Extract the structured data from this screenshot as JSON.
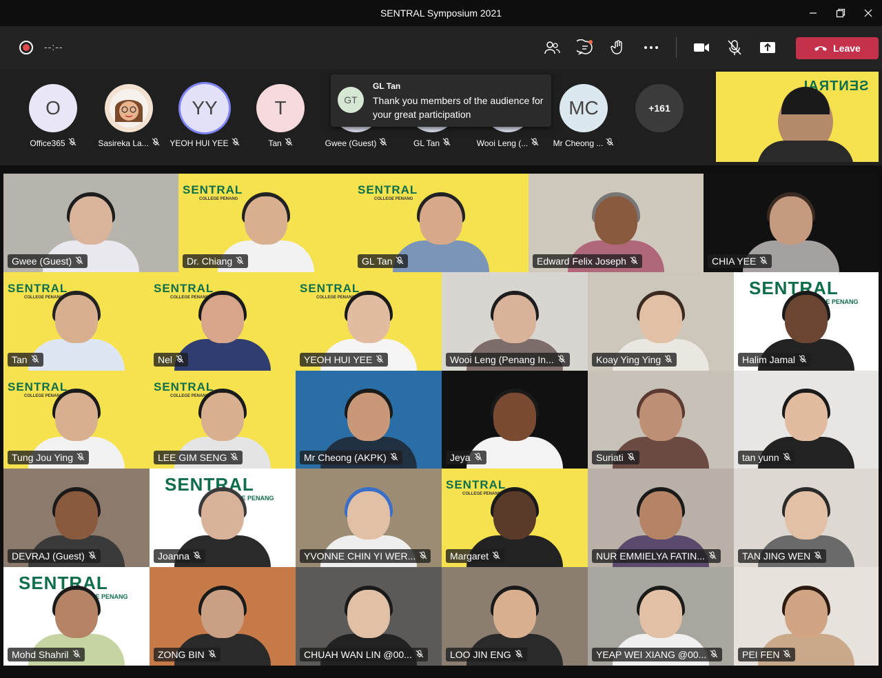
{
  "window": {
    "title": "SENTRAL Symposium 2021"
  },
  "toolbar": {
    "timer": "--:--",
    "leave_label": "Leave"
  },
  "participants_strip": [
    {
      "initials": "O",
      "name": "Office365",
      "color": "#e9e6f7"
    },
    {
      "initials": "",
      "name": "Sasireka La...",
      "color": "#f3e2d2"
    },
    {
      "initials": "YY",
      "name": "YEOH HUI YEE",
      "color": "#e3e1f7",
      "active": true
    },
    {
      "initials": "T",
      "name": "Tan",
      "color": "#f7dadd"
    },
    {
      "initials": "",
      "name": "Gwee (Guest)",
      "color": "#dde0ef"
    },
    {
      "initials": "",
      "name": "GL Tan",
      "color": "#dde0ef"
    },
    {
      "initials": "",
      "name": "Wooi Leng (...",
      "color": "#dde0ef"
    },
    {
      "initials": "MC",
      "name": "Mr Cheong ...",
      "color": "#dbe8ee"
    }
  ],
  "more_count": "+161",
  "chat_popup": {
    "initials": "GT",
    "from": "GL Tan",
    "message": "Thank you members of the audience for your great participation"
  },
  "presenter_banner": "SENTRAL",
  "banner_sub": "COLLEGE PENANG",
  "tiles": [
    {
      "name": "Gwee (Guest)"
    },
    {
      "name": "Dr. Chiang"
    },
    {
      "name": "GL Tan"
    },
    {
      "name": "Edward Felix  Joseph"
    },
    {
      "name": "CHIA YEE"
    },
    {
      "name": "Tan"
    },
    {
      "name": "Nel"
    },
    {
      "name": "YEOH HUI YEE"
    },
    {
      "name": "Wooi Leng (Penang In..."
    },
    {
      "name": "Koay Ying Ying"
    },
    {
      "name": "Halim Jamal"
    },
    {
      "name": "Tung  Jou Ying"
    },
    {
      "name": "LEE GIM SENG"
    },
    {
      "name": "Mr Cheong (AKPK)"
    },
    {
      "name": "Jeya"
    },
    {
      "name": "Suriati"
    },
    {
      "name": "tan yunn"
    },
    {
      "name": "DEVRAJ (Guest)"
    },
    {
      "name": "Joanna"
    },
    {
      "name": "YVONNE CHIN YI WER..."
    },
    {
      "name": "Margaret"
    },
    {
      "name": "NUR EMMIELYA FATIN..."
    },
    {
      "name": "TAN JING WEN"
    },
    {
      "name": "Mohd Shahril"
    },
    {
      "name": "ZONG BIN"
    },
    {
      "name": "CHUAH WAN LIN @00..."
    },
    {
      "name": "LOO JIN ENG"
    },
    {
      "name": "YEAP WEI XIANG @00..."
    },
    {
      "name": "PEI FEN"
    }
  ],
  "colors": {
    "leave": "#c4314b",
    "accent": "#7f85f5",
    "banner_yellow": "#f5e24e",
    "sentral_green": "#0f6e4a"
  }
}
